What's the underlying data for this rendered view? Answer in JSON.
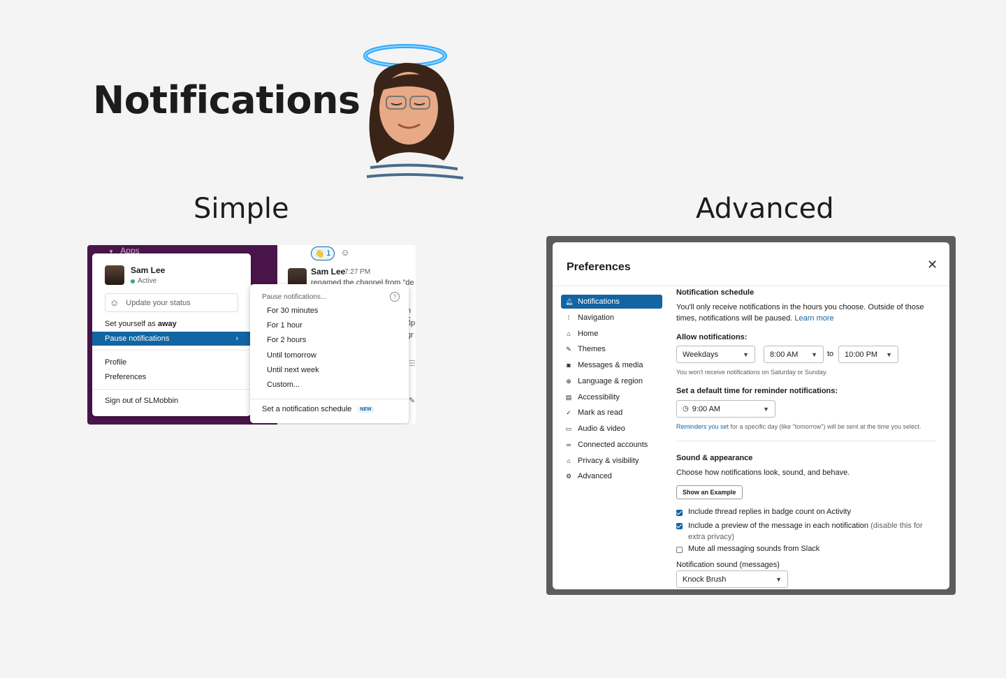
{
  "hero": {
    "title": "Notifications"
  },
  "labels": {
    "simple": "Simple",
    "advanced": "Advanced"
  },
  "simple": {
    "sidebar": {
      "apps_label": "Apps"
    },
    "chat": {
      "reaction_count": "1",
      "author": "Sam Lee",
      "time": "7:27 PM",
      "renamed_text": "renamed the channel from \"de",
      "fragments": [
        "n c",
        "up",
        "gr"
      ]
    },
    "profile_menu": {
      "name": "Sam Lee",
      "status": "Active",
      "update_status": "Update your status",
      "set_away_prefix": "Set yourself as ",
      "set_away_bold": "away",
      "pause_notifications": "Pause notifications",
      "profile": "Profile",
      "preferences": "Preferences",
      "sign_out": "Sign out of SLMobbin"
    },
    "pause_menu": {
      "header": "Pause notifications...",
      "options": [
        "For 30 minutes",
        "For 1 hour",
        "For 2 hours",
        "Until tomorrow",
        "Until next week",
        "Custom..."
      ],
      "schedule": "Set a notification schedule",
      "badge": "NEW"
    }
  },
  "advanced": {
    "title": "Preferences",
    "nav": [
      {
        "label": "Notifications",
        "icon": "bell-icon",
        "glyph": "🔔",
        "active": true
      },
      {
        "label": "Navigation",
        "icon": "navigation-icon",
        "glyph": "⁞"
      },
      {
        "label": "Home",
        "icon": "home-icon",
        "glyph": "⌂"
      },
      {
        "label": "Themes",
        "icon": "brush-icon",
        "glyph": "✎"
      },
      {
        "label": "Messages & media",
        "icon": "message-icon",
        "glyph": "◙"
      },
      {
        "label": "Language & region",
        "icon": "globe-icon",
        "glyph": "⊕"
      },
      {
        "label": "Accessibility",
        "icon": "accessibility-icon",
        "glyph": "▤"
      },
      {
        "label": "Mark as read",
        "icon": "check-circle-icon",
        "glyph": "✓"
      },
      {
        "label": "Audio & video",
        "icon": "video-icon",
        "glyph": "▭"
      },
      {
        "label": "Connected accounts",
        "icon": "link-icon",
        "glyph": "∞"
      },
      {
        "label": "Privacy & visibility",
        "icon": "lock-icon",
        "glyph": "⌂"
      },
      {
        "label": "Advanced",
        "icon": "gear-icon",
        "glyph": "⚙"
      }
    ],
    "schedule": {
      "heading": "Notification schedule",
      "desc": "You'll only receive notifications in the hours you choose. Outside of those times, notifications will be paused.",
      "learn_more": "Learn more",
      "allow_label": "Allow notifications:",
      "days": "Weekdays",
      "from": "8:00 AM",
      "to_word": "to",
      "to": "10:00 PM",
      "note": "You won't receive notifications on Saturday or Sunday.",
      "reminder_label": "Set a default time for reminder notifications:",
      "reminder_time": "9:00 AM",
      "reminder_note_link": "Reminders you set",
      "reminder_note": " for a specific day (like \"tomorrow\") will be sent at the time you select."
    },
    "sound": {
      "heading": "Sound & appearance",
      "desc": "Choose how notifications look, sound, and behave.",
      "example_button": "Show an Example",
      "opt_thread": "Include thread replies in badge count on Activity",
      "opt_preview": "Include a preview of the message in each notification",
      "opt_preview_hint": " (disable this for extra privacy)",
      "opt_mute": "Mute all messaging sounds from Slack",
      "sound_label": "Notification sound (messages)",
      "sound_value": "Knock Brush"
    }
  },
  "colors": {
    "accent": "#1264a3",
    "aubergine": "#4a154b",
    "active_green": "#2bac76"
  }
}
